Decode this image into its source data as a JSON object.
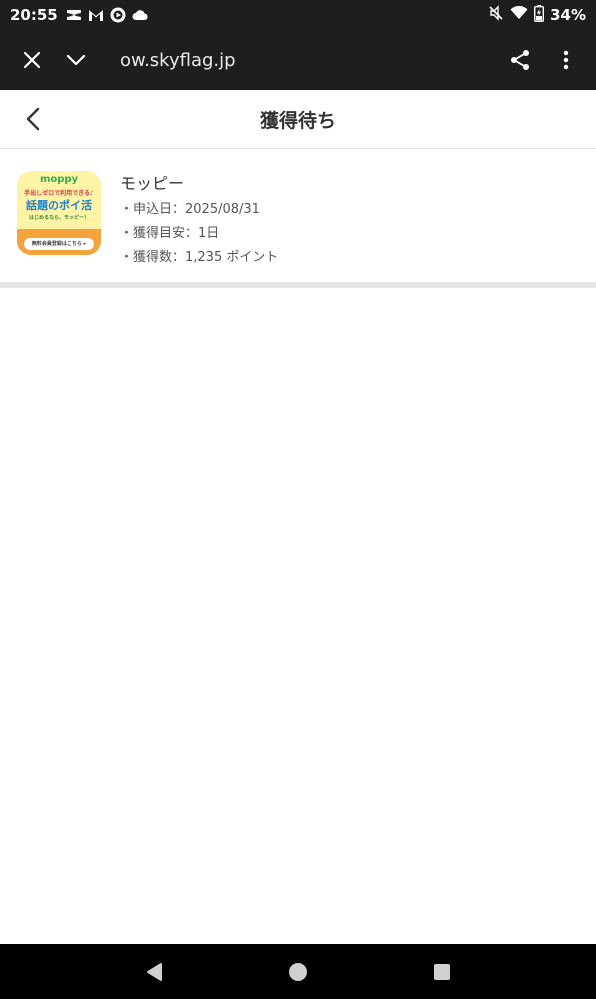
{
  "status_bar": {
    "time": "20:55",
    "battery": "34%",
    "icons": [
      "capcut-icon",
      "gmail-icon",
      "media-icon",
      "cloud-icon",
      "mute-icon",
      "wifi-icon",
      "battery-icon"
    ]
  },
  "browser": {
    "url": "ow.skyflag.jp"
  },
  "page": {
    "title": "獲得待ち"
  },
  "items": [
    {
      "name": "モッピー",
      "details": [
        "・申込日：2025/08/31",
        "・獲得目安：1日",
        "・獲得数：1,235 ポイント"
      ],
      "thumbnail": {
        "logo": "moppy",
        "line1": "手出しゼロで利用できる♪",
        "line2": "話題のポイ活",
        "line3": "はじめるなら、モッピー！",
        "pill": "無料会員登録はこちら ▸"
      }
    }
  ],
  "colors": {
    "dark_bar": "#1e1e1e",
    "thumb_bg": "#fff4a6",
    "thumb_banner": "#f5a33a"
  }
}
